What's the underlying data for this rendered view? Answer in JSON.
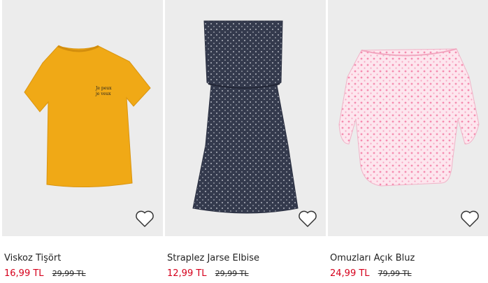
{
  "products": [
    {
      "name": "Viskoz Tişört",
      "price": "16,99 TL",
      "original_price": "29,99 TL",
      "color": "#f2ab1a",
      "chest_print": [
        "Je peux",
        "je veux"
      ]
    },
    {
      "name": "Straplez Jarse Elbise",
      "price": "12,99 TL",
      "original_price": "29,99 TL",
      "color": "#33394c"
    },
    {
      "name": "Omuzları Açık Bluz",
      "price": "24,99 TL",
      "original_price": "79,99 TL",
      "color": "#f7c6d6"
    }
  ],
  "icons": {
    "favorite": "heart-outline-icon"
  },
  "colors": {
    "sale_price": "#d6001c",
    "background": "#ececec"
  }
}
